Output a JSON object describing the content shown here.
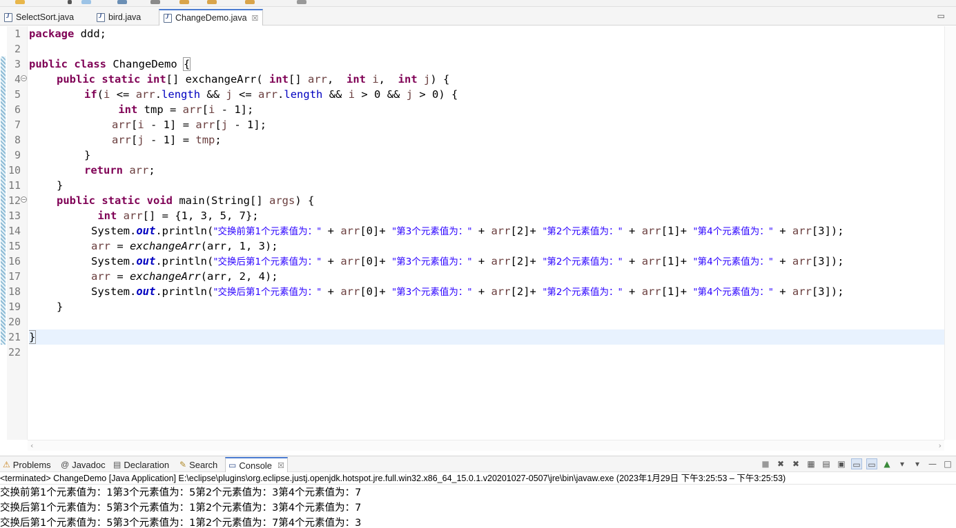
{
  "editor_tabs": [
    {
      "label": "SelectSort.java",
      "active": false
    },
    {
      "label": "bird.java",
      "active": false
    },
    {
      "label": "ChangeDemo.java",
      "active": true
    }
  ],
  "close_glyph": "☒",
  "code": {
    "t": {
      "package": "package",
      "ddd": " ddd;",
      "public": "public",
      "class": " class",
      "ChangeDemo": " ChangeDemo ",
      "brace": "{",
      "static": " static",
      "int": " int",
      "intarr": "[] ",
      "exchangeArr": "exchangeArr",
      "lparen": "(",
      "arr": "arr",
      "comma_sp": ", ",
      "i": "i",
      "j": "j",
      "rparen_brace": ") {",
      "if": "if",
      "le": " <= ",
      "dot": ".",
      "length": "length",
      "and": " && ",
      "gt0": " > 0",
      "close_if": " > 0) {",
      "tmp_decl": " tmp = ",
      "tmp": "tmp",
      "idx_open": "[",
      "minus1": " - 1]",
      "assign": " = ",
      "semi": ";",
      "close": "}",
      "return": "return",
      "void": " void",
      "main": " main(String[] ",
      "args": "args",
      "arr_init": "[] = {1, 3, 5, 7};",
      "System": "System.",
      "out": "out",
      "println": ".println(",
      "plus": " + ",
      "plusq": "+ ",
      "idx0": "[0]",
      "idx1": "[1]",
      "idx2": "[2]",
      "idx3": "[3]",
      "end_stmt": ");",
      "call1": "(arr, 1, 3);",
      "call2": "(arr, 2, 4);"
    },
    "strings": {
      "before1": "\"交换前第1个元素值为：\"",
      "after1": "\"交换后第1个元素值为：\"",
      "third": "\"第3个元素值为：\"",
      "second": "\"第2个元素值为：\"",
      "fourth": "\"第4个元素值为：\""
    },
    "line_numbers": [
      "1",
      "2",
      "3",
      "4",
      "5",
      "6",
      "7",
      "8",
      "9",
      "10",
      "11",
      "12",
      "13",
      "14",
      "15",
      "16",
      "17",
      "18",
      "19",
      "20",
      "21",
      "22"
    ]
  },
  "view_tabs": [
    {
      "label": "Problems",
      "icon": "problems-icon",
      "glyph": "⚠"
    },
    {
      "label": "Javadoc",
      "icon": "at-icon",
      "glyph": "@"
    },
    {
      "label": "Declaration",
      "icon": "declaration-icon",
      "glyph": "▤"
    },
    {
      "label": "Search",
      "icon": "search-flashlight-icon",
      "glyph": "✎"
    },
    {
      "label": "Console",
      "icon": "console-icon",
      "glyph": "▭"
    }
  ],
  "console": {
    "terminated": "<terminated> ChangeDemo [Java Application] E:\\eclipse\\plugins\\org.eclipse.justj.openjdk.hotspot.jre.full.win32.x86_64_15.0.1.v20201027-0507\\jre\\bin\\javaw.exe  (2023年1月29日 下午3:25:53 – 下午3:25:53)",
    "output": [
      "交换前第1个元素值为：1第3个元素值为：5第2个元素值为：3第4个元素值为：7",
      "交换后第1个元素值为：5第3个元素值为：1第2个元素值为：3第4个元素值为：7",
      "交换后第1个元素值为：5第3个元素值为：1第2个元素值为：7第4个元素值为：3"
    ]
  },
  "colors": {
    "keyword": "#7f0055",
    "field": "#0000c0",
    "string": "#2a00ff",
    "variable": "#6a3e3e",
    "current_line": "#e8f2fe",
    "active_tab_accent": "#4a7bd0"
  }
}
